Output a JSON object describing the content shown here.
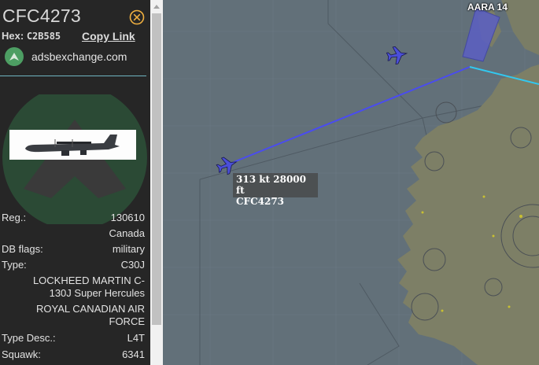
{
  "aircraft": {
    "callsign": "CFC4273",
    "hex_label": "Hex:",
    "hex": "C2B585",
    "copy_link": "Copy Link",
    "source": "adsbexchange.com"
  },
  "details": [
    {
      "label": "Reg.:",
      "value": "130610"
    },
    {
      "label": "",
      "value": "Canada"
    },
    {
      "label": "DB flags:",
      "value": "military"
    },
    {
      "label": "Type:",
      "value": "C30J"
    }
  ],
  "type_name": [
    "LOCKHEED MARTIN C-",
    "130J Super Hercules"
  ],
  "operator": [
    "ROYAL CANADIAN AIR",
    "FORCE"
  ],
  "details2": [
    {
      "label": "Type Desc.:",
      "value": "L4T"
    },
    {
      "label": "Squawk:",
      "value": "6341"
    }
  ],
  "map": {
    "track_label_line1": "313 kt  28000 ft",
    "track_label_line2": "CFC4273",
    "airspace_label": "AARA 14",
    "colors": {
      "sea": "#627079",
      "land": "#7d7f66",
      "track": "#4a4cf0",
      "track_fade": "#32c8f0",
      "aircraft": "#4b4fd8",
      "airspace": "#5b5fc4"
    }
  }
}
